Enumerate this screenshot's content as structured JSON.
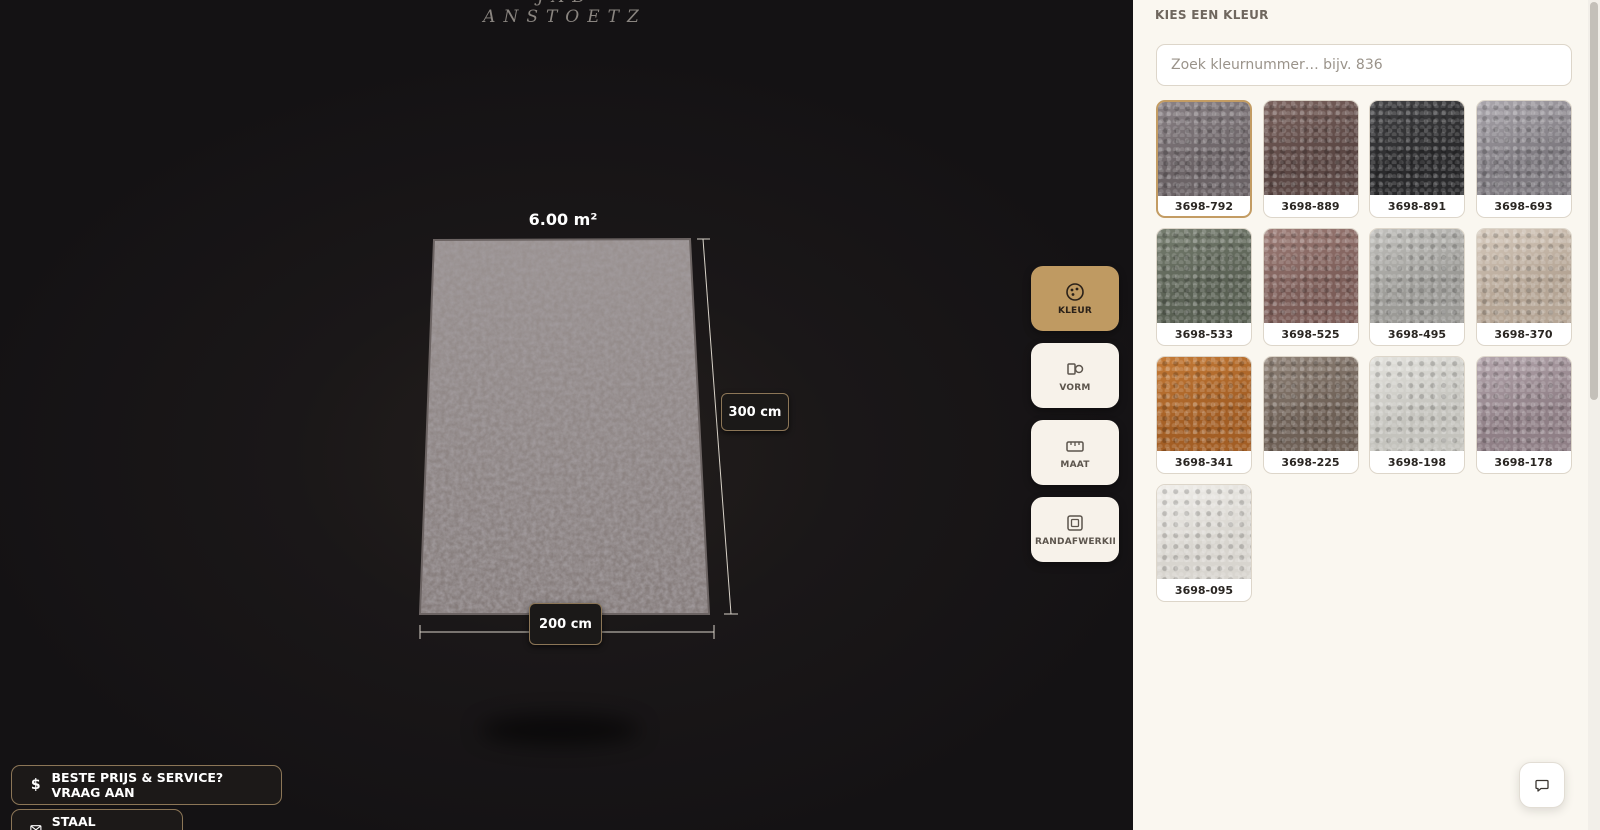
{
  "brand": {
    "name": "JAB ANSTOETZ"
  },
  "viewer": {
    "area_label": "6.00 m²",
    "height_label": "300 cm",
    "width_label": "200 cm"
  },
  "tools": [
    {
      "label": "KLEUR",
      "icon": "palette-icon",
      "active": true
    },
    {
      "label": "VORM",
      "icon": "shapes-icon",
      "active": false
    },
    {
      "label": "MAAT",
      "icon": "ruler-icon",
      "active": false
    },
    {
      "label": "RANDAFWERKING",
      "icon": "border-icon",
      "active": false
    }
  ],
  "actions": {
    "price_label": "BESTE PRIJS & SERVICE? VRAAG AAN",
    "price_icon": "dollar-icon",
    "sample_label": "STAAL AANVRAGEN",
    "sample_icon": "mail-icon"
  },
  "panel": {
    "title": "KIES EEN KLEUR",
    "search_placeholder": "Zoek kleurnummer… bijv. 836",
    "search_value": "",
    "selected": "3698-792",
    "swatches": [
      {
        "code": "3698-792",
        "color": "#6b6366",
        "color2": "#8a8286"
      },
      {
        "code": "3698-889",
        "color": "#5b4744",
        "color2": "#7a625d"
      },
      {
        "code": "3698-891",
        "color": "#2a2a2c",
        "color2": "#414143"
      },
      {
        "code": "3698-693",
        "color": "#7e7a80",
        "color2": "#aaa6ac"
      },
      {
        "code": "3698-533",
        "color": "#5a6154",
        "color2": "#767d6f"
      },
      {
        "code": "3698-525",
        "color": "#7c5d58",
        "color2": "#9c7c76"
      },
      {
        "code": "3698-495",
        "color": "#9b9a96",
        "color2": "#c2c1bd"
      },
      {
        "code": "3698-370",
        "color": "#b5a595",
        "color2": "#d6cabd"
      },
      {
        "code": "3698-341",
        "color": "#a35e24",
        "color2": "#c47a36"
      },
      {
        "code": "3698-225",
        "color": "#6e6056",
        "color2": "#8f8277"
      },
      {
        "code": "3698-198",
        "color": "#c4c3bd",
        "color2": "#e3e2dd"
      },
      {
        "code": "3698-178",
        "color": "#8f7f86",
        "color2": "#b4a6ad"
      },
      {
        "code": "3698-095",
        "color": "#d8d5cf",
        "color2": "#f0eeea"
      }
    ]
  },
  "chat": {
    "icon": "chat-icon"
  }
}
